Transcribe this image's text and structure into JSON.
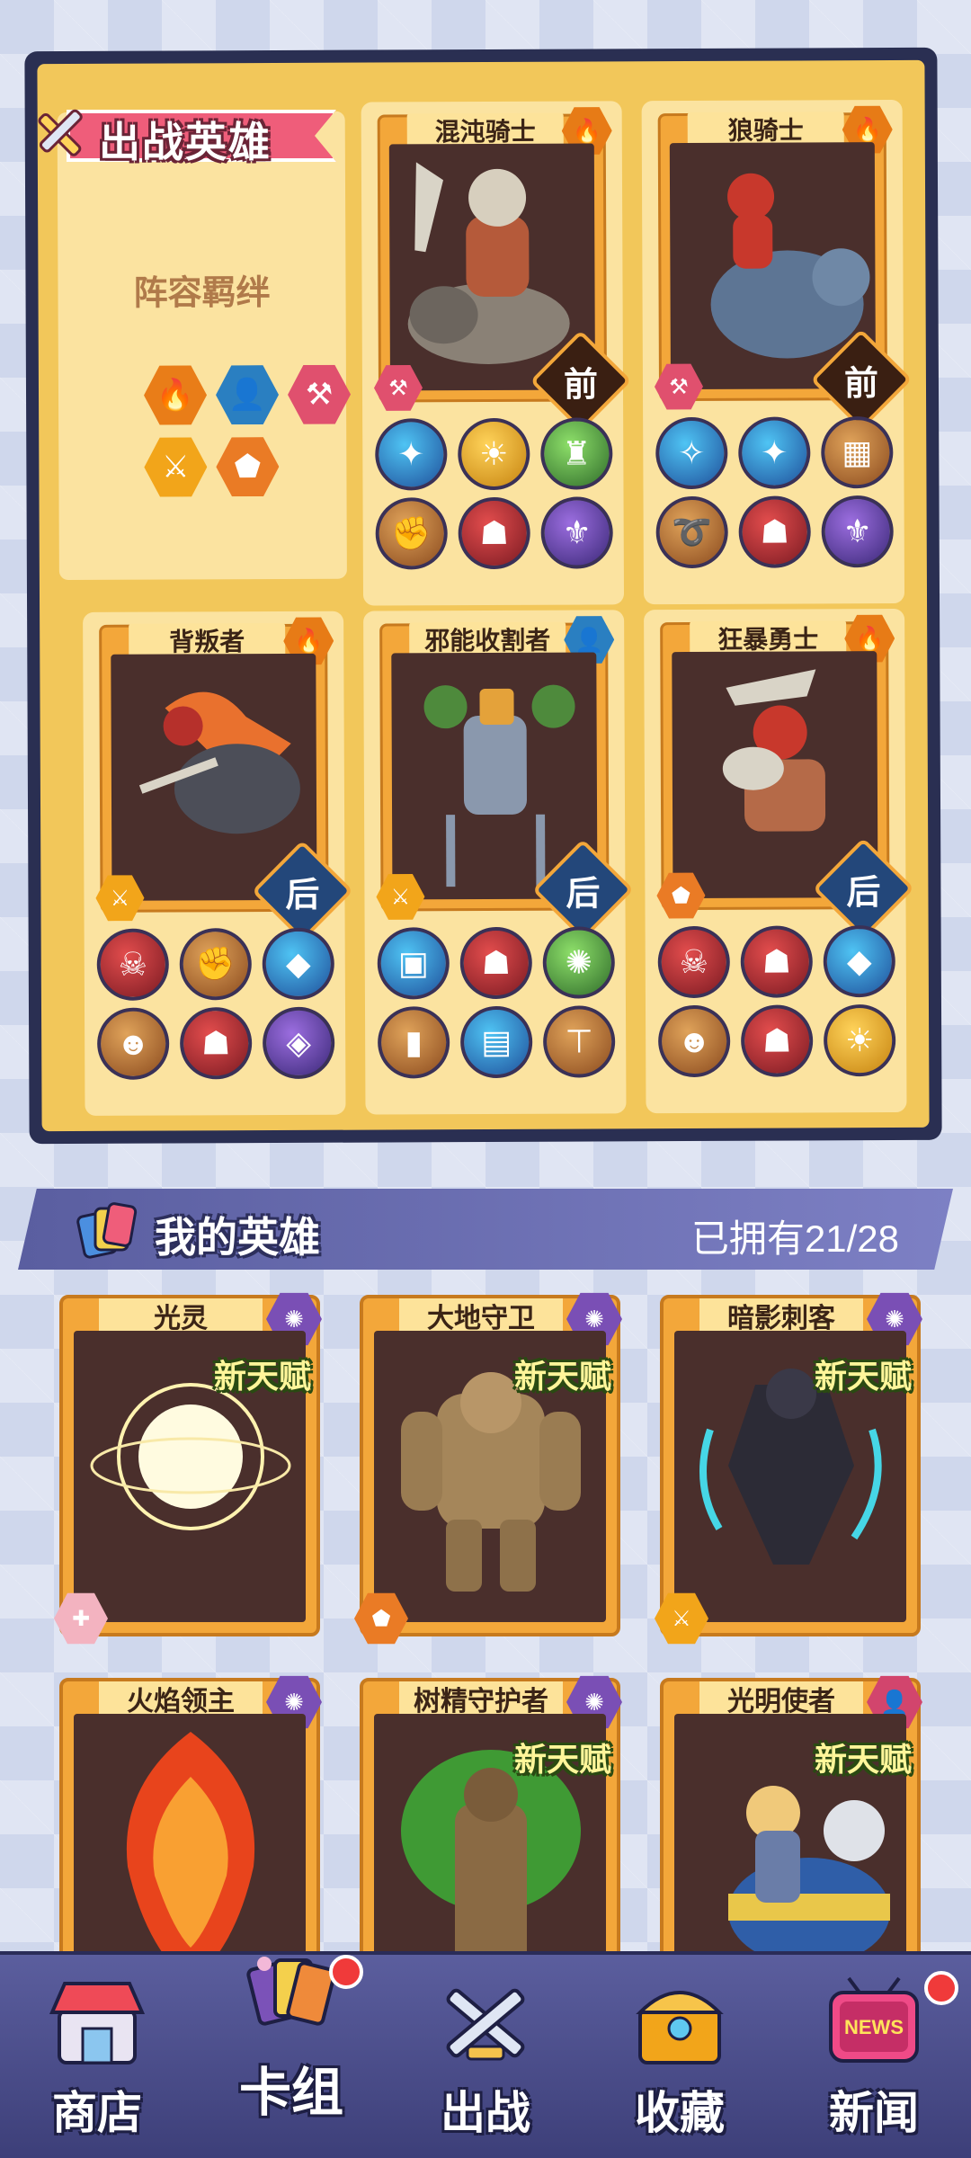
{
  "battle": {
    "title": "出战英雄",
    "bond_title": "阵容羁绊",
    "bonds": [
      {
        "icon": "flame-icon",
        "color": "#e97d18",
        "glyph": "🔥"
      },
      {
        "icon": "assassin-icon",
        "color": "#2a7fc1",
        "glyph": "👤"
      },
      {
        "icon": "hammer-icon",
        "color": "#e0506e",
        "glyph": "⚒"
      },
      {
        "icon": "blades-icon",
        "color": "#f2a51a",
        "glyph": "⚔"
      },
      {
        "icon": "shield-icon",
        "color": "#ea7b25",
        "glyph": "⬟"
      }
    ],
    "heroes": [
      {
        "name": "混沌骑士",
        "position": "前",
        "skills": [
          "sk-blue",
          "sk-gold",
          "sk-green",
          "sk-brown",
          "sk-red",
          "sk-purple"
        ]
      },
      {
        "name": "狼骑士",
        "position": "前",
        "skills": [
          "sk-blue",
          "sk-blue",
          "sk-brown",
          "sk-brown",
          "sk-red",
          "sk-purple"
        ]
      },
      {
        "name": "背叛者",
        "position": "后",
        "skills": [
          "sk-red",
          "sk-brown",
          "sk-blue",
          "sk-brown",
          "sk-red",
          "sk-purple"
        ]
      },
      {
        "name": "邪能收割者",
        "position": "后",
        "skills": [
          "sk-blue",
          "sk-red",
          "sk-green",
          "sk-brown",
          "sk-blue",
          "sk-brown"
        ]
      },
      {
        "name": "狂暴勇士",
        "position": "后",
        "skills": [
          "sk-red",
          "sk-red",
          "sk-blue",
          "sk-brown",
          "sk-red",
          "sk-gold"
        ]
      }
    ]
  },
  "my_heroes": {
    "title": "我的英雄",
    "count": "已拥有21/28",
    "new_talent": "新天赋",
    "cards": [
      {
        "name": "光灵",
        "new": true
      },
      {
        "name": "大地守卫",
        "new": true
      },
      {
        "name": "暗影刺客",
        "new": true
      },
      {
        "name": "火焰领主",
        "new": false
      },
      {
        "name": "树精守护者",
        "new": true
      },
      {
        "name": "光明使者",
        "new": true
      }
    ]
  },
  "nav": {
    "shop": "商店",
    "deck": "卡组",
    "battle": "出战",
    "collection": "收藏",
    "news": "新闻",
    "news_badge": "NEWS"
  },
  "colors": {
    "accent": "#f3a73a",
    "panel": "#f2c75a",
    "nav": "#4a4c8a",
    "banner": "#ef5d7a"
  }
}
